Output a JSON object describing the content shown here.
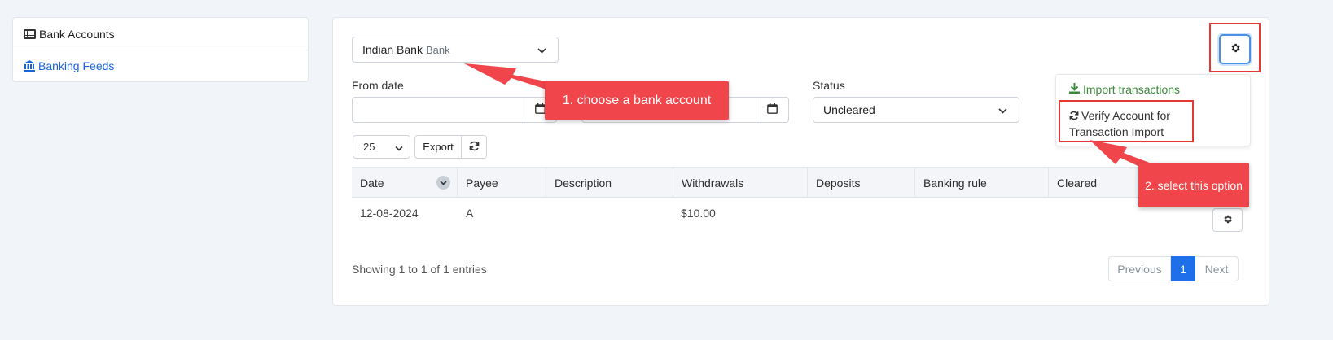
{
  "sidebar": {
    "items": [
      {
        "label": "Bank Accounts",
        "icon": "list-icon"
      },
      {
        "label": "Banking Feeds",
        "icon": "bank-icon"
      }
    ]
  },
  "filters": {
    "account": {
      "name": "Indian Bank",
      "type": "Bank"
    },
    "from_date_label": "From date",
    "from_date_value": "",
    "to_date_value": "",
    "status_label": "Status",
    "status_value": "Uncleared"
  },
  "toolbar": {
    "page_size": "25",
    "export_label": "Export"
  },
  "table": {
    "columns": [
      "Date",
      "Payee",
      "Description",
      "Withdrawals",
      "Deposits",
      "Banking rule",
      "Cleared"
    ],
    "rows": [
      {
        "date": "12-08-2024",
        "payee": "A",
        "description": "",
        "withdrawals": "$10.00",
        "deposits": "",
        "banking_rule": "",
        "cleared": ""
      }
    ]
  },
  "footer": {
    "showing": "Showing 1 to 1 of 1 entries",
    "pagination": {
      "previous": "Previous",
      "current": "1",
      "next": "Next"
    }
  },
  "menu": {
    "import": "Import transactions",
    "verify": "Verify Account for Transaction Import"
  },
  "annotations": {
    "step1": "1. choose a bank account",
    "step2": "2. select this option"
  },
  "colors": {
    "accent": "#1f6feb",
    "callout": "#f0454b",
    "import_green": "#3b8a3b"
  }
}
